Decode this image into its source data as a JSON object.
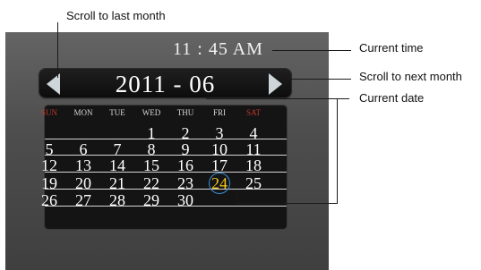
{
  "callouts": {
    "scroll_last": "Scroll to last month",
    "current_time": "Current time",
    "scroll_next": "Scroll to next month",
    "current_date": "Current date"
  },
  "clock": {
    "time": "11 : 45  AM"
  },
  "date_bar": {
    "date": "2011 - 06"
  },
  "calendar": {
    "weekdays": [
      "SUN",
      "MON",
      "TUE",
      "WED",
      "THU",
      "FRI",
      "SAT"
    ],
    "weeks": [
      [
        "",
        "",
        "",
        "1",
        "2",
        "3",
        "4"
      ],
      [
        "5",
        "6",
        "7",
        "8",
        "9",
        "10",
        "11"
      ],
      [
        "12",
        "13",
        "14",
        "15",
        "16",
        "17",
        "18"
      ],
      [
        "19",
        "20",
        "21",
        "22",
        "23",
        "24",
        "25"
      ],
      [
        "26",
        "27",
        "28",
        "29",
        "30",
        "",
        ""
      ]
    ],
    "selected_day": "24"
  },
  "colors": {
    "weekend_header": "#c0392b",
    "selected_day_text": "#f5c518",
    "selected_ring": "#3b8fd6"
  }
}
